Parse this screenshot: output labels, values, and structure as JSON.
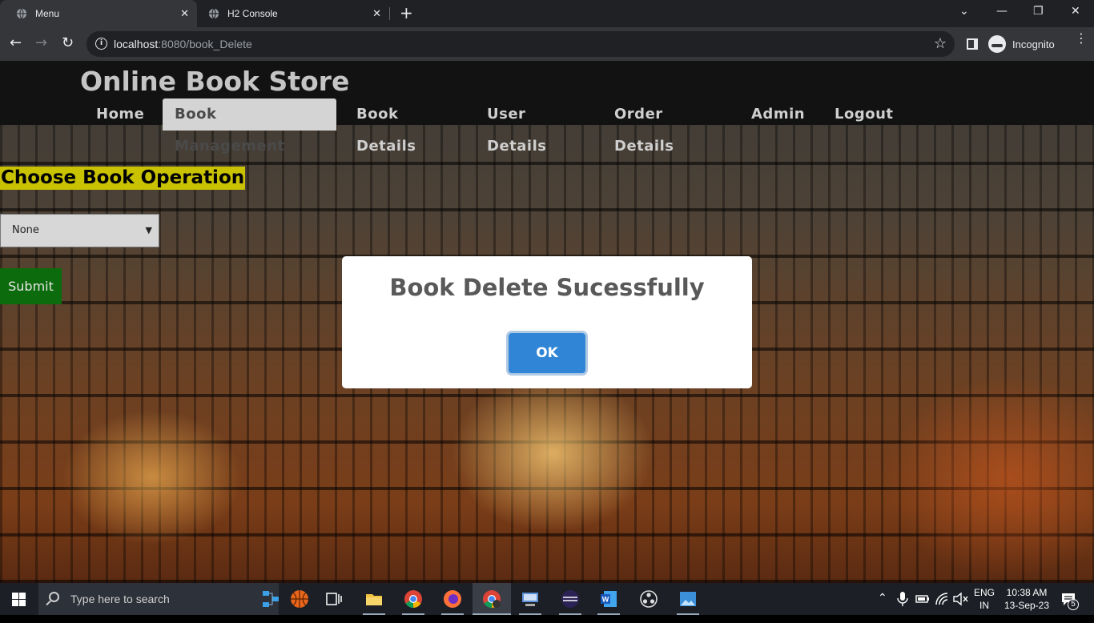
{
  "browser": {
    "tabs": [
      {
        "title": "Menu",
        "active": true
      },
      {
        "title": "H2 Console",
        "active": false
      }
    ],
    "url_host": "localhost",
    "url_path": ":8080/book_Delete",
    "profile_label": "Incognito"
  },
  "site": {
    "title": "Online Book Store",
    "nav": [
      "Home",
      "Book Management",
      "Book Details",
      "User Details",
      "Order Details",
      "Admin",
      "Logout"
    ],
    "active_nav": "Book Management"
  },
  "form": {
    "heading": "Choose Book Operation",
    "select_value": "None",
    "submit_label": "Submit"
  },
  "modal": {
    "title": "Book Delete Sucessfully",
    "ok_label": "OK"
  },
  "taskbar": {
    "search_placeholder": "Type here to search",
    "lang_line1": "ENG",
    "lang_line2": "IN",
    "time": "10:38 AM",
    "date": "13-Sep-23",
    "notification_count": "5"
  },
  "colors": {
    "heading_bg": "#c9c200",
    "submit_bg": "#0c6b0c",
    "ok_bg": "#3085d6"
  }
}
